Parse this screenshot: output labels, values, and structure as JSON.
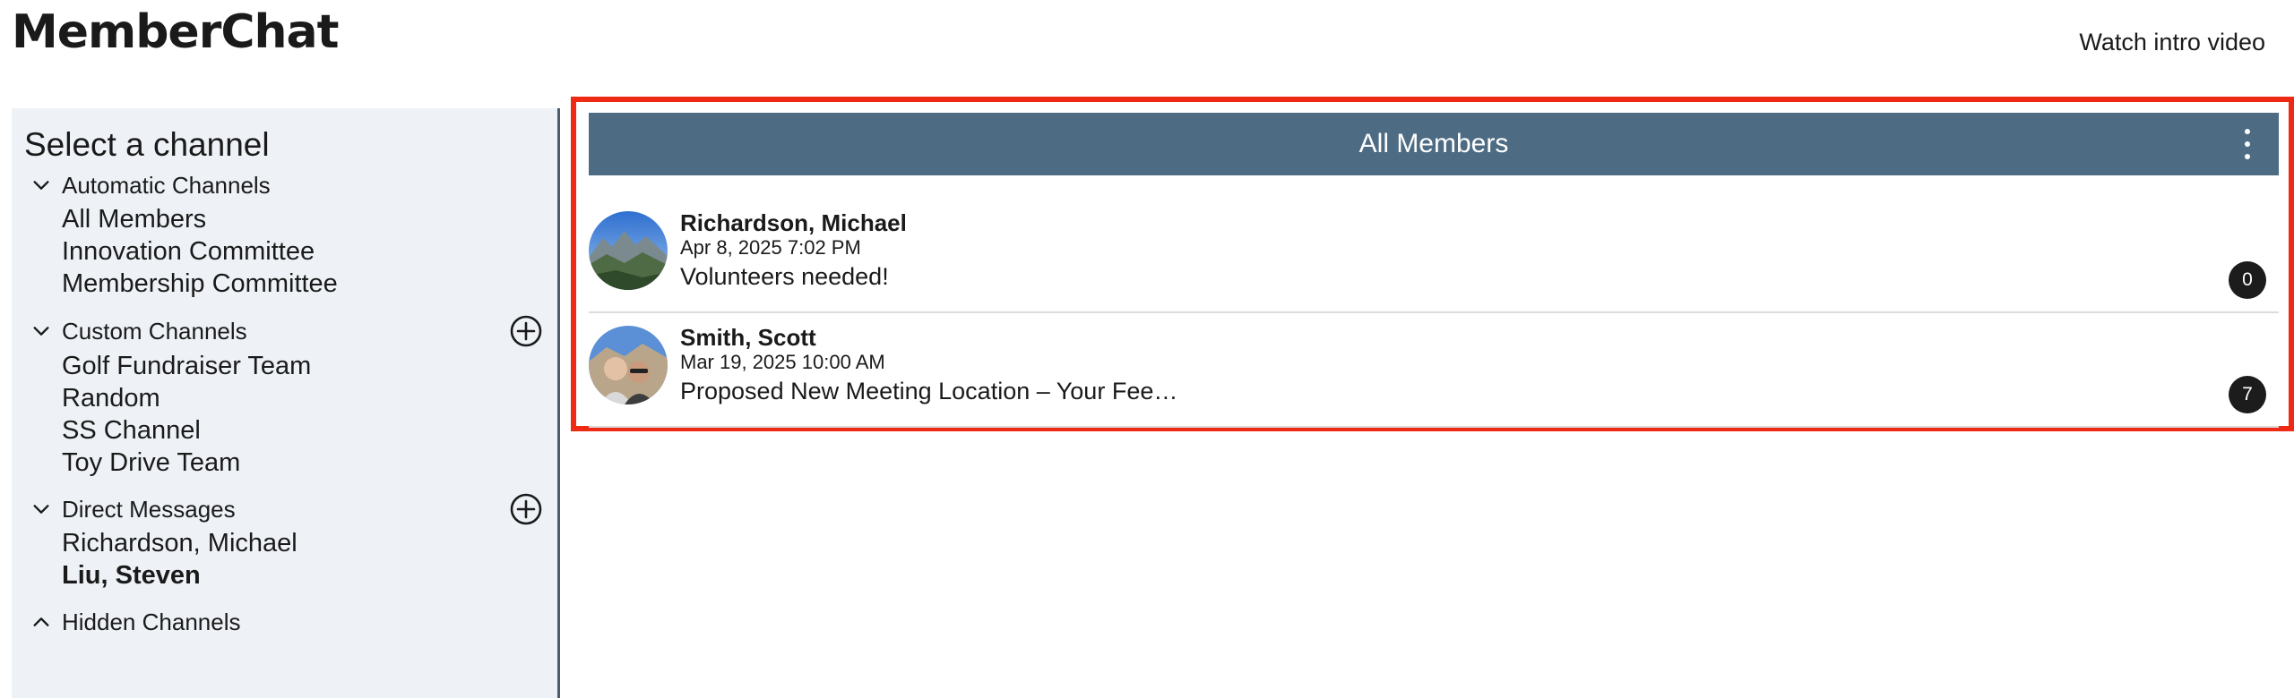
{
  "app": {
    "title": "MemberChat",
    "intro_link": "Watch intro video"
  },
  "sidebar": {
    "heading": "Select a channel",
    "groups": [
      {
        "label": "Automatic Channels",
        "expanded": true,
        "channels": [
          "All Members",
          "Innovation Committee",
          "Membership Committee"
        ]
      },
      {
        "label": "Custom Channels",
        "expanded": true,
        "channels": [
          "Golf Fundraiser Team",
          "Random",
          "SS Channel",
          "Toy Drive Team"
        ]
      },
      {
        "label": "Direct Messages",
        "expanded": true,
        "channels": [
          "Richardson, Michael",
          "Liu, Steven"
        ]
      },
      {
        "label": "Hidden Channels",
        "expanded": false,
        "channels": []
      }
    ]
  },
  "main": {
    "channel_title": "All Members",
    "messages": [
      {
        "author": "Richardson, Michael",
        "date": "Apr 8, 2025 7:02 PM",
        "preview": "Volunteers needed!",
        "count": "0",
        "avatar": "mountain-landscape"
      },
      {
        "author": "Smith, Scott",
        "date": "Mar 19, 2025 10:00 AM",
        "preview": "Proposed New Meeting Location – Your Fee…",
        "count": "7",
        "avatar": "couple-selfie"
      }
    ]
  },
  "colors": {
    "channel_bar": "#4d6c83",
    "highlight_border": "#ee2a14",
    "sidebar_bg": "#eef2f7",
    "badge": "#1c1c1c"
  },
  "icons": {
    "expanded": "chevron-down-icon",
    "collapsed": "chevron-up-icon",
    "add": "plus-circle-icon",
    "menu": "kebab-menu-icon"
  }
}
